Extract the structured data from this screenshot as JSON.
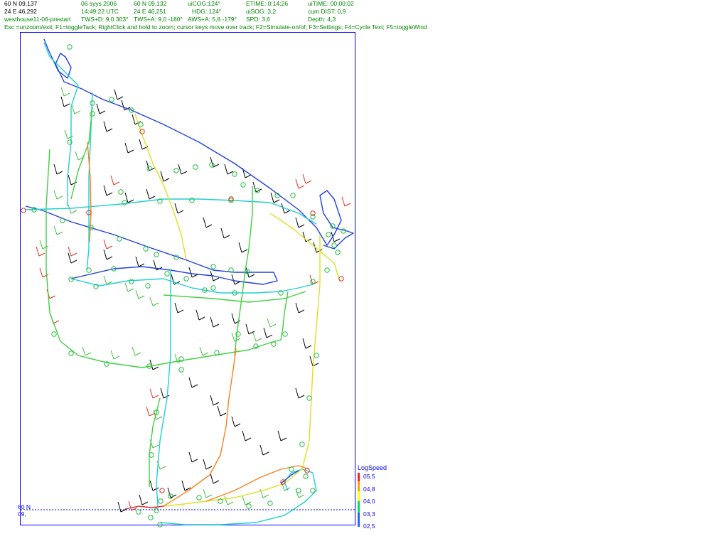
{
  "header": {
    "col1": {
      "lat": "60 N 09,137",
      "lon": "24 E 46,292",
      "file": "westhouse11-06-prestart"
    },
    "col2": {
      "date": "06 syys 2006",
      "time": "14:49:22  UTC",
      "tws": "TWS+D: 9,0 303°"
    },
    "col3": {
      "lat": "60 N 09,132",
      "lon": "24 E 46,251",
      "twa": "TWS+A: 9,0 -180°"
    },
    "col4": {
      "cog": "uiCOG:124°",
      "hdg": "HDG: 124°",
      "aws": "AWS+A: 5,8 -179°"
    },
    "col5": {
      "etime": "ETIME: 0:14:26",
      "sog": "uiSOG: 3,2",
      "spd": "SPD: 3,6"
    },
    "col6": {
      "uitime": "uiTIME: 00:00:02",
      "dist": "cum DIST: 0,9",
      "depth": "Depth: 4,3"
    },
    "help": "Esc =unzoom/exit; F1=toggleTack; RightClick and hold to zoom; cursor keys move over track; F2=Simulate-on/of; F3=Settings; F4=Cycle Text; F5=toggleWind"
  },
  "grid": {
    "lat_label": "60 N",
    "min_label": "09,"
  },
  "legend": {
    "title": "LogSpeed",
    "labels": [
      "05,5",
      "04,8",
      "04,0",
      "03,3",
      "02,5"
    ],
    "colors": [
      "#ff2020",
      "#ffa000",
      "#ffff00",
      "#00e060",
      "#3060ff"
    ]
  },
  "colors": {
    "frame": "#0000ff",
    "track_blue": "#2040e0",
    "track_cyan": "#20d0d0",
    "track_green": "#40d040",
    "track_yellow": "#e0e020",
    "track_orange": "#ff8020",
    "track_red": "#e03020",
    "wind_black": "#000000",
    "wind_green": "#40c040",
    "wind_red": "#e03020",
    "marker_green": "#20c040",
    "marker_red": "#e03020"
  }
}
